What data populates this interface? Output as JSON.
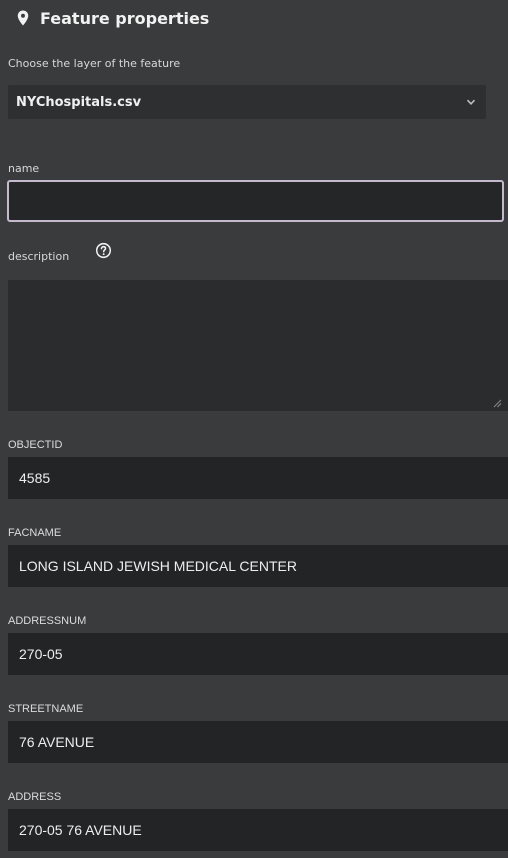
{
  "header": {
    "icon": "map-pin-icon",
    "title": "Feature properties"
  },
  "layer_select": {
    "label": "Choose the layer of the feature",
    "value": "NYChospitals.csv",
    "icon": "chevron-down-icon"
  },
  "name_field": {
    "label": "name",
    "value": ""
  },
  "description_field": {
    "label": "description",
    "help_icon": "help-circle-icon",
    "value": ""
  },
  "properties": [
    {
      "label": "OBJECTID",
      "value": "4585"
    },
    {
      "label": "FACNAME",
      "value": "LONG ISLAND JEWISH MEDICAL CENTER"
    },
    {
      "label": "ADDRESSNUM",
      "value": "270-05"
    },
    {
      "label": "STREETNAME",
      "value": "76 AVENUE"
    },
    {
      "label": "ADDRESS",
      "value": "270-05 76 AVENUE"
    }
  ],
  "colors": {
    "panel_bg": "#3a3b3c",
    "field_bg": "#232425",
    "focus_border": "#c5b9cf"
  }
}
